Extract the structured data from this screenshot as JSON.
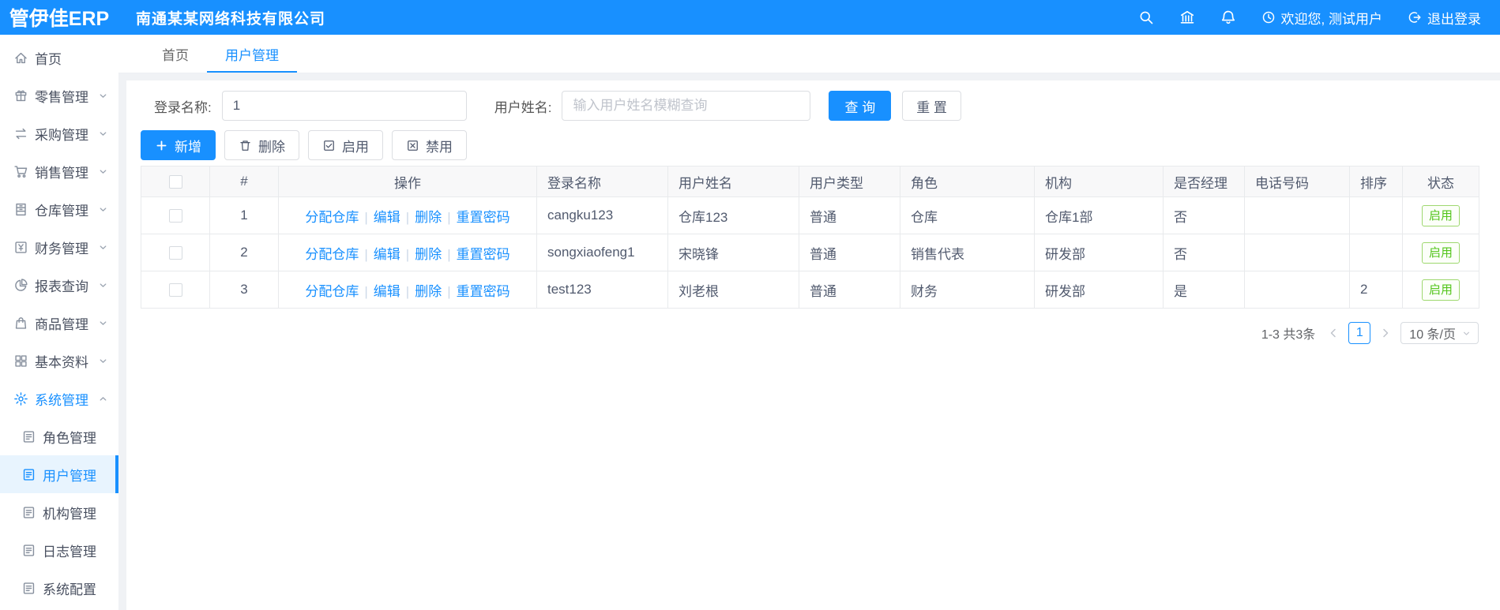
{
  "header": {
    "logo": "管伊佳ERP",
    "company": "南通某某网络科技有限公司",
    "welcome": "欢迎您, 测试用户",
    "logout": "退出登录"
  },
  "sidebar": {
    "items": [
      {
        "id": "home",
        "label": "首页",
        "icon": "home-icon"
      },
      {
        "id": "retail",
        "label": "零售管理",
        "icon": "retail-icon",
        "chevron": "down"
      },
      {
        "id": "purchase",
        "label": "采购管理",
        "icon": "purchase-icon",
        "chevron": "down"
      },
      {
        "id": "sales",
        "label": "销售管理",
        "icon": "sales-icon",
        "chevron": "down"
      },
      {
        "id": "warehouse",
        "label": "仓库管理",
        "icon": "warehouse-icon",
        "chevron": "down"
      },
      {
        "id": "finance",
        "label": "财务管理",
        "icon": "finance-icon",
        "chevron": "down"
      },
      {
        "id": "report",
        "label": "报表查询",
        "icon": "report-icon",
        "chevron": "down"
      },
      {
        "id": "product",
        "label": "商品管理",
        "icon": "product-icon",
        "chevron": "down"
      },
      {
        "id": "basic-data",
        "label": "基本资料",
        "icon": "basic-data-icon",
        "chevron": "down"
      },
      {
        "id": "system",
        "label": "系统管理",
        "icon": "gear-icon",
        "chevron": "up",
        "active": true,
        "children": [
          {
            "id": "role",
            "label": "角色管理"
          },
          {
            "id": "user",
            "label": "用户管理",
            "active": true
          },
          {
            "id": "org",
            "label": "机构管理"
          },
          {
            "id": "log",
            "label": "日志管理"
          },
          {
            "id": "config",
            "label": "系统配置"
          }
        ]
      }
    ]
  },
  "tabs": [
    {
      "label": "首页"
    },
    {
      "label": "用户管理",
      "active": true
    }
  ],
  "filters": {
    "login_name_label": "登录名称:",
    "login_name_value": "1",
    "user_name_label": "用户姓名:",
    "user_name_placeholder": "输入用户姓名模糊查询",
    "search_label": "查 询",
    "reset_label": "重 置"
  },
  "toolbar": {
    "add": "新增",
    "delete": "删除",
    "enable": "启用",
    "disable": "禁用"
  },
  "table": {
    "columns": [
      "#",
      "操作",
      "登录名称",
      "用户姓名",
      "用户类型",
      "角色",
      "机构",
      "是否经理",
      "电话号码",
      "排序",
      "状态"
    ],
    "action_links": [
      "分配仓库",
      "编辑",
      "删除",
      "重置密码"
    ],
    "rows": [
      {
        "index": "1",
        "login": "cangku123",
        "name": "仓库123",
        "type": "普通",
        "role": "仓库",
        "org": "仓库1部",
        "manager": "否",
        "phone": "",
        "sort": "",
        "status": "启用"
      },
      {
        "index": "2",
        "login": "songxiaofeng1",
        "name": "宋晓锋",
        "type": "普通",
        "role": "销售代表",
        "org": "研发部",
        "manager": "否",
        "phone": "",
        "sort": "",
        "status": "启用"
      },
      {
        "index": "3",
        "login": "test123",
        "name": "刘老根",
        "type": "普通",
        "role": "财务",
        "org": "研发部",
        "manager": "是",
        "phone": "",
        "sort": "2",
        "status": "启用"
      }
    ]
  },
  "pagination": {
    "total": "1-3 共3条",
    "page": "1",
    "page_size": "10 条/页"
  },
  "colors": {
    "primary": "#1890ff",
    "success": "#52c41a"
  }
}
